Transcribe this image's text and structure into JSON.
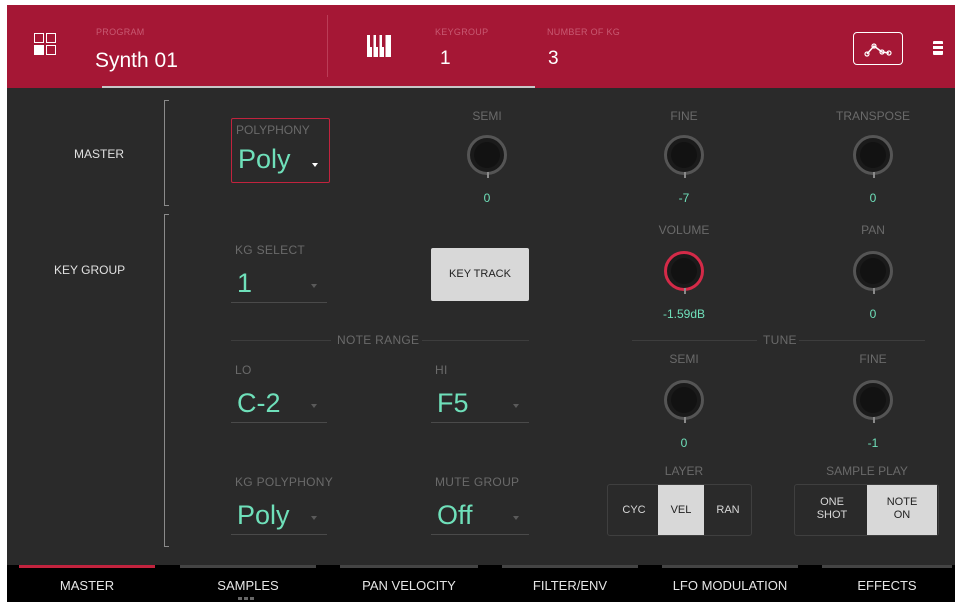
{
  "header": {
    "program_label": "PROGRAM",
    "program_value": "Synth 01",
    "keygroup_label": "KEYGROUP",
    "keygroup_value": "1",
    "keygroups_label": "NUMBER OF KG",
    "keygroups_value": "3",
    "icons": [
      "grid-menu-icon",
      "keyboard-icon",
      "envelope-icon",
      "battery-icon"
    ],
    "accent_color": "#a51735"
  },
  "sections": {
    "master": "MASTER",
    "key_group": "KEY GROUP"
  },
  "master": {
    "polyphony_label": "POLYPHONY",
    "polyphony_value": "Poly",
    "semi_label": "SEMI",
    "semi_value": "0",
    "fine_label": "FINE",
    "fine_value": "-7",
    "transpose_label": "TRANSPOSE",
    "transpose_value": "0"
  },
  "keygroup": {
    "kg_select_label": "KG SELECT",
    "kg_select_value": "1",
    "key_track_label": "KEY TRACK",
    "volume_label": "VOLUME",
    "volume_value": "-1.59dB",
    "pan_label": "PAN",
    "pan_value": "0",
    "note_range_label": "NOTE RANGE",
    "lo_label": "LO",
    "lo_value": "C-2",
    "hi_label": "HI",
    "hi_value": "F5",
    "tune_label": "TUNE",
    "tune_semi_label": "SEMI",
    "tune_semi_value": "0",
    "tune_fine_label": "FINE",
    "tune_fine_value": "-1",
    "kg_polyphony_label": "KG POLYPHONY",
    "kg_polyphony_value": "Poly",
    "mute_group_label": "MUTE GROUP",
    "mute_group_value": "Off",
    "layer_label": "LAYER",
    "layer_options": [
      "CYC",
      "VEL",
      "RAN"
    ],
    "layer_selected": "VEL",
    "sample_play_label": "SAMPLE PLAY",
    "sample_play_options": [
      [
        "ONE",
        "SHOT"
      ],
      [
        "NOTE",
        "ON"
      ]
    ],
    "sample_play_selected": "NOTE ON"
  },
  "tabs": [
    "MASTER",
    "SAMPLES",
    "PAN VELOCITY",
    "FILTER/ENV",
    "LFO MODULATION",
    "EFFECTS"
  ],
  "active_tab": "MASTER",
  "colors": {
    "value_text": "#6fe0ba",
    "selected_outline": "#c2233e",
    "active_button": "#d8d8d8"
  }
}
